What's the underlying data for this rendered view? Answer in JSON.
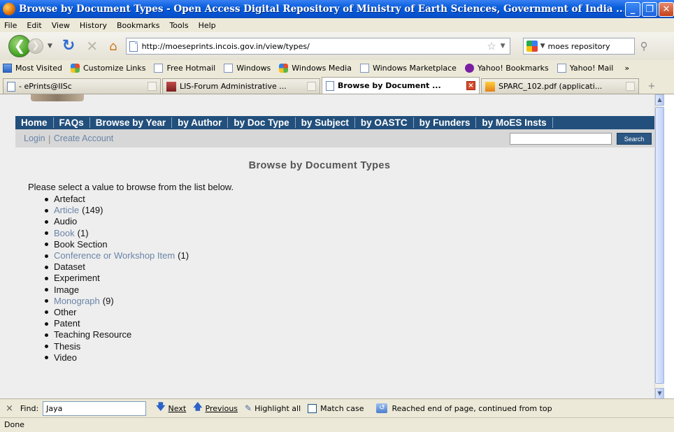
{
  "window": {
    "title": "Browse by Document Types - Open Access Digital Repository of Ministry of Earth Sciences, Government of India ..."
  },
  "menubar": {
    "items": [
      {
        "label": "File"
      },
      {
        "label": "Edit"
      },
      {
        "label": "View"
      },
      {
        "label": "History"
      },
      {
        "label": "Bookmarks"
      },
      {
        "label": "Tools"
      },
      {
        "label": "Help"
      }
    ]
  },
  "navbar": {
    "url": "http://moeseprints.incois.gov.in/view/types/",
    "search_engine_text": "moes repository"
  },
  "bookmarks": {
    "items": [
      {
        "label": "Most Visited"
      },
      {
        "label": "Customize Links"
      },
      {
        "label": "Free Hotmail"
      },
      {
        "label": "Windows"
      },
      {
        "label": "Windows Media"
      },
      {
        "label": "Windows Marketplace"
      },
      {
        "label": "Yahoo! Bookmarks"
      },
      {
        "label": "Yahoo! Mail"
      }
    ],
    "more": "»"
  },
  "tabs": [
    {
      "label": "- ePrints@IISc"
    },
    {
      "label": "LIS-Forum Administrative ..."
    },
    {
      "label": "Browse by Document ..."
    },
    {
      "label": "SPARC_102.pdf (applicati..."
    }
  ],
  "site": {
    "nav": [
      {
        "label": "Home"
      },
      {
        "label": "FAQs"
      },
      {
        "label": "Browse by Year"
      },
      {
        "label": "by Author"
      },
      {
        "label": "by Doc Type"
      },
      {
        "label": "by Subject"
      },
      {
        "label": "by OASTC"
      },
      {
        "label": "by Funders"
      },
      {
        "label": "by MoES Insts"
      }
    ],
    "login_label": "Login",
    "login_separator": "|",
    "create_account_label": "Create Account",
    "search_button_label": "Search"
  },
  "page": {
    "title": "Browse by Document Types",
    "intro": "Please select a value to browse from the list below.",
    "types": [
      {
        "name": "Artefact",
        "link": false,
        "count": ""
      },
      {
        "name": "Article",
        "link": true,
        "count": "(149)"
      },
      {
        "name": "Audio",
        "link": false,
        "count": ""
      },
      {
        "name": "Book",
        "link": true,
        "count": "(1)"
      },
      {
        "name": "Book Section",
        "link": false,
        "count": ""
      },
      {
        "name": "Conference or Workshop Item",
        "link": true,
        "count": "(1)"
      },
      {
        "name": "Dataset",
        "link": false,
        "count": ""
      },
      {
        "name": "Experiment",
        "link": false,
        "count": ""
      },
      {
        "name": "Image",
        "link": false,
        "count": ""
      },
      {
        "name": "Monograph",
        "link": true,
        "count": "(9)"
      },
      {
        "name": "Other",
        "link": false,
        "count": ""
      },
      {
        "name": "Patent",
        "link": false,
        "count": ""
      },
      {
        "name": "Teaching Resource",
        "link": false,
        "count": ""
      },
      {
        "name": "Thesis",
        "link": false,
        "count": ""
      },
      {
        "name": "Video",
        "link": false,
        "count": ""
      }
    ]
  },
  "findbar": {
    "close_glyph": "×",
    "label": "Find:",
    "value": "Jaya",
    "next_label": "Next",
    "previous_label": "Previous",
    "highlight_label": "Highlight all",
    "match_case_label": "Match case",
    "status": "Reached end of page, continued from top"
  },
  "statusbar": {
    "text": "Done"
  }
}
